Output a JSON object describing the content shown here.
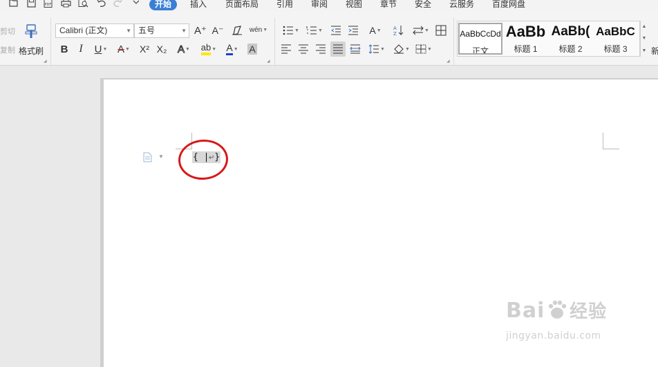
{
  "quick_access": {
    "icons": [
      "folder-open-icon",
      "save-icon",
      "pdf-icon",
      "print-icon",
      "print-preview-icon",
      "undo-icon",
      "redo-icon",
      "customize-dropdown-icon"
    ],
    "pdf_text": "PDF"
  },
  "tabs": [
    {
      "label": "开始",
      "active": true
    },
    {
      "label": "插入",
      "active": false
    },
    {
      "label": "页面布局",
      "active": false
    },
    {
      "label": "引用",
      "active": false
    },
    {
      "label": "审阅",
      "active": false
    },
    {
      "label": "视图",
      "active": false
    },
    {
      "label": "章节",
      "active": false
    },
    {
      "label": "安全",
      "active": false
    },
    {
      "label": "云服务",
      "active": false
    },
    {
      "label": "百度网盘",
      "active": false
    }
  ],
  "clipboard": {
    "cut_label": "剪切",
    "copy_label": "复制",
    "format_painter_label": "格式刷"
  },
  "font": {
    "font_name": "Calibri (正文)",
    "font_size": "五号",
    "glyphs": {
      "grow": "A⁺",
      "shrink": "A⁻",
      "pinyin": "wén",
      "bold": "B",
      "italic": "I",
      "underline": "U",
      "strike": "A",
      "superscript": "X²",
      "subscript": "X₂",
      "text_effect": "A",
      "highlight": "ab",
      "font_color": "A",
      "char_shading": "A"
    }
  },
  "styles": [
    {
      "preview": "AaBbCcDd",
      "name": "正文",
      "selected": true
    },
    {
      "preview": "AaBb",
      "name": "标题 1",
      "selected": false
    },
    {
      "preview": "AaBb(",
      "name": "标题 2",
      "selected": false
    },
    {
      "preview": "AaBbC",
      "name": "标题 3",
      "selected": false
    }
  ],
  "styles_more_label": "新",
  "document": {
    "field_code": "{ | }",
    "paragraph_mark": "↵"
  },
  "watermark": {
    "brand": "Bai",
    "brand_tail": "经验",
    "url": "jingyan.baidu.com"
  },
  "colors": {
    "accent_tab": "#3a7fd5",
    "highlight_yellow": "#ffe600",
    "font_color_blue": "#1a3fd0",
    "annotation_red": "#d81818"
  }
}
